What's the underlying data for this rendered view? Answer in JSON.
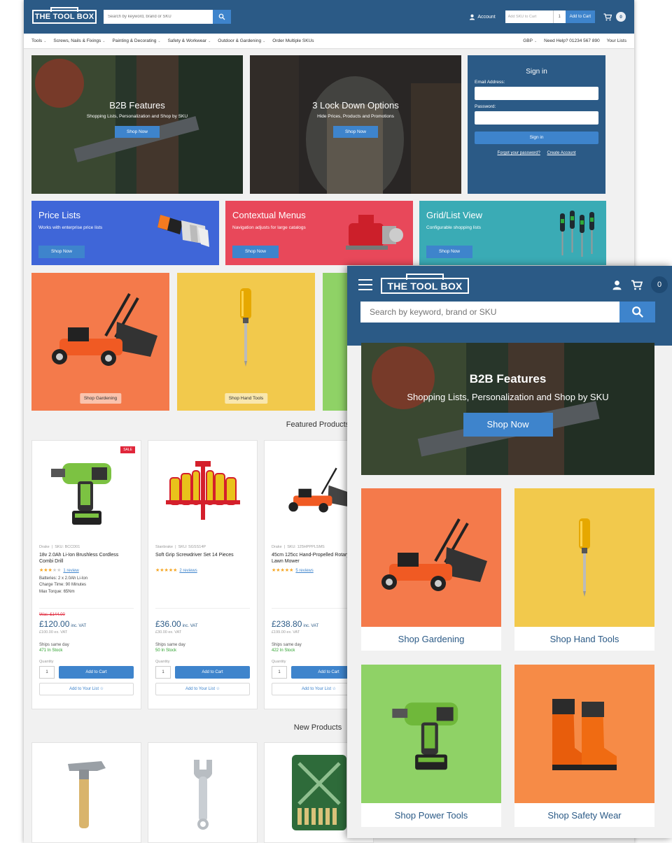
{
  "desktop": {
    "header": {
      "logo": "THE TOOL BOX",
      "search_placeholder": "Search by keyword, brand or SKU",
      "account": "Account",
      "sku_placeholder": "Add SKU to Cart",
      "qty": "1",
      "add_to_cart": "Add to Cart",
      "cart_count": "0"
    },
    "nav": {
      "items": [
        "Tools",
        "Screws, Nails & Fixings",
        "Painting & Decorating",
        "Safety & Workwear",
        "Outdoor & Gardening"
      ],
      "order_multiple": "Order Multiple SKUs",
      "currency": "GBP",
      "help": "Need Help? 01234 567 890",
      "lists": "Your Lists"
    },
    "heroes": [
      {
        "title": "B2B Features",
        "subtitle": "Shopping Lists, Personalization and Shop by SKU",
        "button": "Shop Now"
      },
      {
        "title": "3 Lock Down Options",
        "subtitle": "Hide Prices, Products and Promotions",
        "button": "Shop Now"
      }
    ],
    "signin": {
      "title": "Sign in",
      "email_label": "Email Address:",
      "password_label": "Password:",
      "button": "Sign in",
      "forgot": "Forgot your password?",
      "create": "Create Account"
    },
    "promos": [
      {
        "title": "Price Lists",
        "subtitle": "Works with enterprise price lists",
        "button": "Shop Now",
        "color": "#3f66d8"
      },
      {
        "title": "Contextual Menus",
        "subtitle": "Navigation adjusts for large catalogs",
        "button": "Shop Now",
        "color": "#e8485a"
      },
      {
        "title": "Grid/List View",
        "subtitle": "Configurable shopping lists",
        "button": "Shop Now",
        "color": "#3aabb5"
      }
    ],
    "tiles": [
      "Shop Gardening",
      "Shop Hand Tools"
    ],
    "featured_title": "Featured Products",
    "products": [
      {
        "brand": "Drake",
        "sku": "SKU: BCCD01",
        "name": "18v 2.0Ah Li-Ion Brushless Cordless Combi Drill",
        "stars": 3,
        "reviews": "1 review",
        "specs": [
          "Batteries: 2 x 2.0Ah Li-Ion",
          "Charge Time: 90 Minutes",
          "Max Torque: 65Nm"
        ],
        "sale": "SALE",
        "was": "Was: £144.00",
        "price": "£120.00",
        "vat": "inc. VAT",
        "ex_vat": "£100.00 ex. VAT",
        "ships": "Ships same day",
        "stock": "471 In Stock",
        "qty_label": "Quantity",
        "qty": "1",
        "add": "Add to Cart",
        "list": "Add to Your List ☆"
      },
      {
        "brand": "Stanbrake",
        "sku": "SKU: SGSS14P",
        "name": "Soft Grip Screwdriver Set 14 Pieces",
        "stars": 5,
        "reviews": "2 reviews",
        "specs": [],
        "sale": "",
        "was": "",
        "price": "£36.00",
        "vat": "inc. VAT",
        "ex_vat": "£30.00 ex. VAT",
        "ships": "Ships same day",
        "stock": "50 In Stock",
        "qty_label": "Quantity",
        "qty": "1",
        "add": "Add to Cart",
        "list": "Add to Your List ☆"
      },
      {
        "brand": "Drake",
        "sku": "SKU: 125HPPPLSMS",
        "name": "45cm 125cc Hand-Propelled Rotary Petrol Lawn Mower",
        "stars": 5,
        "reviews": "5 reviews",
        "specs": [],
        "sale": "",
        "was": "",
        "price": "£238.80",
        "vat": "inc. VAT",
        "ex_vat": "£199.00 ex. VAT",
        "ships": "Ships same day",
        "stock": "422 In Stock",
        "qty_label": "Quantity",
        "qty": "1",
        "add": "Add to Cart",
        "list": "Add to Your List ☆"
      }
    ],
    "new_title": "New Products"
  },
  "mobile": {
    "logo": "THE TOOL BOX",
    "cart_count": "0",
    "search_placeholder": "Search by keyword, brand or SKU",
    "hero": {
      "title": "B2B Features",
      "subtitle": "Shopping Lists, Personalization and Shop by SKU",
      "button": "Shop Now"
    },
    "tiles": [
      {
        "label": "Shop Gardening",
        "color": "#f47a4b",
        "icon": "lawn-mower-icon"
      },
      {
        "label": "Shop Hand Tools",
        "color": "#f2c94c",
        "icon": "screwdriver-icon"
      },
      {
        "label": "Shop Power Tools",
        "color": "#8fd266",
        "icon": "drill-icon"
      },
      {
        "label": "Shop Safety Wear",
        "color": "#f68b47",
        "icon": "boots-icon"
      }
    ]
  }
}
